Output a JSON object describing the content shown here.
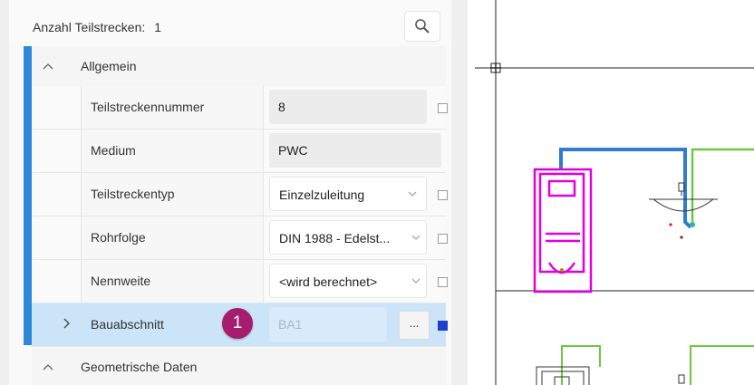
{
  "header": {
    "count_label": "Anzahl Teilstrecken:",
    "count_value": "1",
    "search_icon": "search-icon"
  },
  "groups": {
    "general": "Allgemein",
    "geometry": "Geometrische Daten"
  },
  "properties": [
    {
      "label": "Teilstreckennummer",
      "value": "8"
    },
    {
      "label": "Medium",
      "value": "PWC"
    },
    {
      "label": "Teilstreckentyp",
      "value": "Einzelzuleitung"
    },
    {
      "label": "Rohrfolge",
      "value": "DIN 1988 - Edelst..."
    },
    {
      "label": "Nennweite",
      "value": "<wird berechnet>"
    },
    {
      "label": "Bauabschnitt",
      "value": "BA1"
    }
  ],
  "callout_number": "1",
  "ellipsis_label": "...",
  "colors": {
    "accent_bar": "#2e88d8",
    "selection": "#cce4f7",
    "badge": "#a61c6e",
    "pipe_blue": "#2f7bd8",
    "pipe_green": "#6cc93f",
    "fixture_magenta": "#e000e0"
  }
}
